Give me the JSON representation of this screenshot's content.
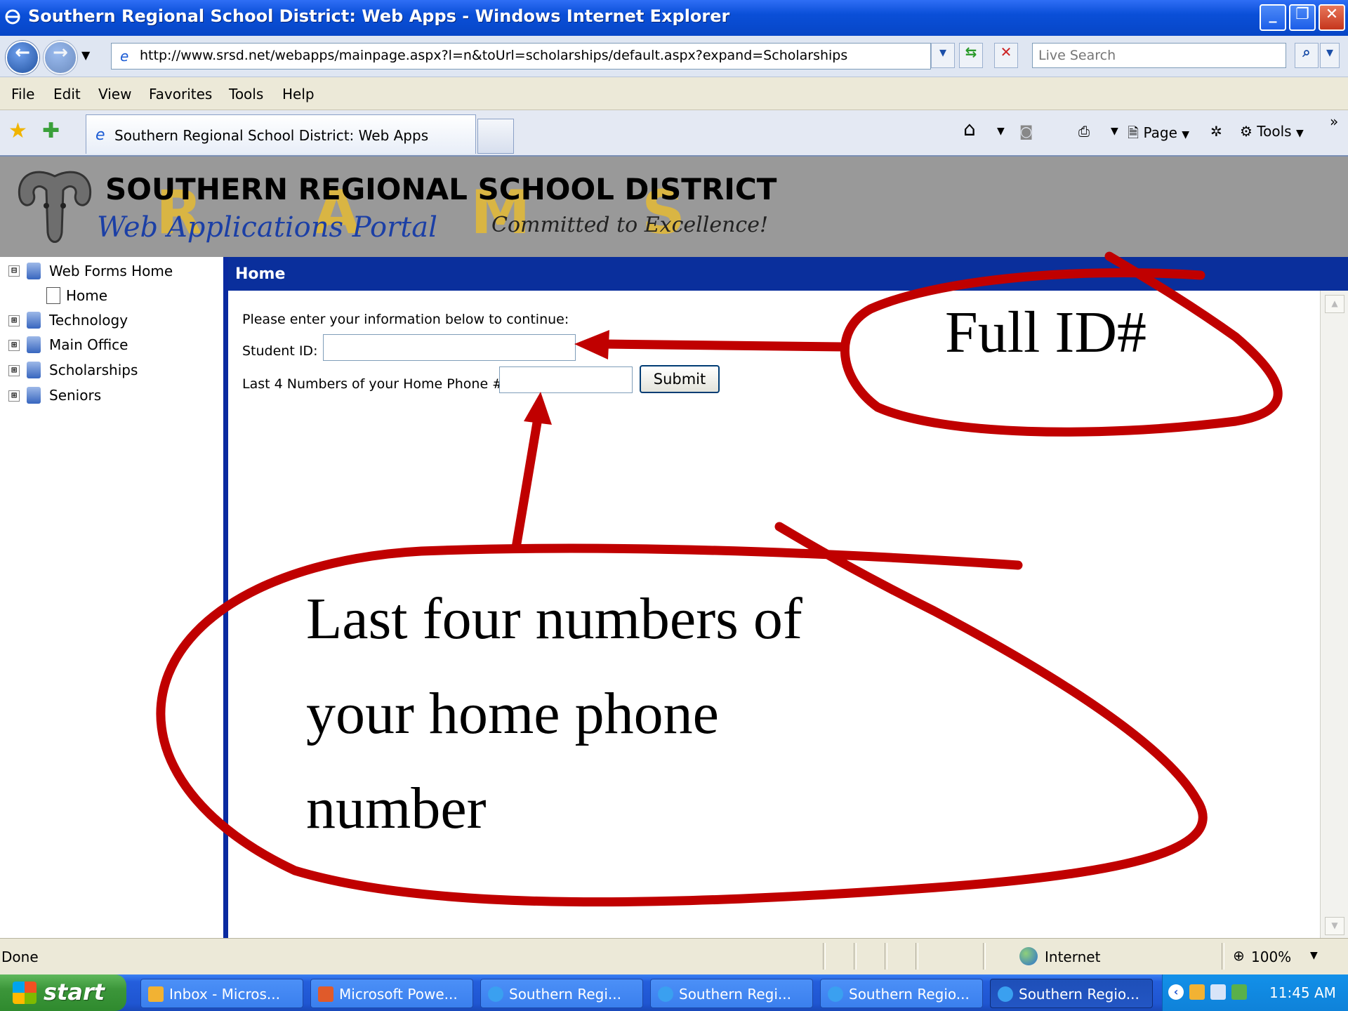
{
  "window": {
    "title": "Southern Regional School District: Web Apps - Windows Internet Explorer"
  },
  "address_bar": {
    "url": "http://www.srsd.net/webapps/mainpage.aspx?l=n&toUrl=scholarships/default.aspx?expand=Scholarships",
    "search_placeholder": "Live Search"
  },
  "menu": [
    "File",
    "Edit",
    "View",
    "Favorites",
    "Tools",
    "Help"
  ],
  "tab": {
    "label": "Southern Regional School District: Web Apps"
  },
  "command_bar": {
    "page_label": "Page",
    "tools_label": "Tools",
    "more": "»"
  },
  "banner": {
    "school_name": "SOUTHERN REGIONAL SCHOOL DISTRICT",
    "portal": "Web Applications Portal",
    "motto": "Committed to Excellence!",
    "mascot_letters": [
      "R",
      "A",
      "M",
      "S"
    ]
  },
  "sidebar": {
    "items": [
      {
        "label": "Web Forms Home",
        "expander": "⊟"
      },
      {
        "label": "Home"
      },
      {
        "label": "Technology",
        "expander": "⊞"
      },
      {
        "label": "Main Office",
        "expander": "⊞"
      },
      {
        "label": "Scholarships",
        "expander": "⊞"
      },
      {
        "label": "Seniors",
        "expander": "⊞"
      }
    ]
  },
  "content": {
    "header": "Home",
    "instructions": "Please enter your information below to continue:",
    "student_id_label": "Student ID:",
    "phone_label": "Last 4 Numbers of your Home Phone #:",
    "submit_label": "Submit"
  },
  "annotations": {
    "id_note": "Full ID#",
    "phone_note_line1": "Last four numbers of",
    "phone_note_line2": "your home phone",
    "phone_note_line3": "number",
    "color": "#c00000"
  },
  "status_bar": {
    "status": "Done",
    "zone": "Internet",
    "zoom": "100%"
  },
  "taskbar": {
    "start_label": "start",
    "buttons": [
      {
        "label": "Inbox - Micros..."
      },
      {
        "label": "Microsoft Powe..."
      },
      {
        "label": "Southern Regi..."
      },
      {
        "label": "Southern Regi..."
      },
      {
        "label": "Southern Regio..."
      },
      {
        "label": "Southern Regio..."
      }
    ],
    "clock": "11:45 AM"
  }
}
